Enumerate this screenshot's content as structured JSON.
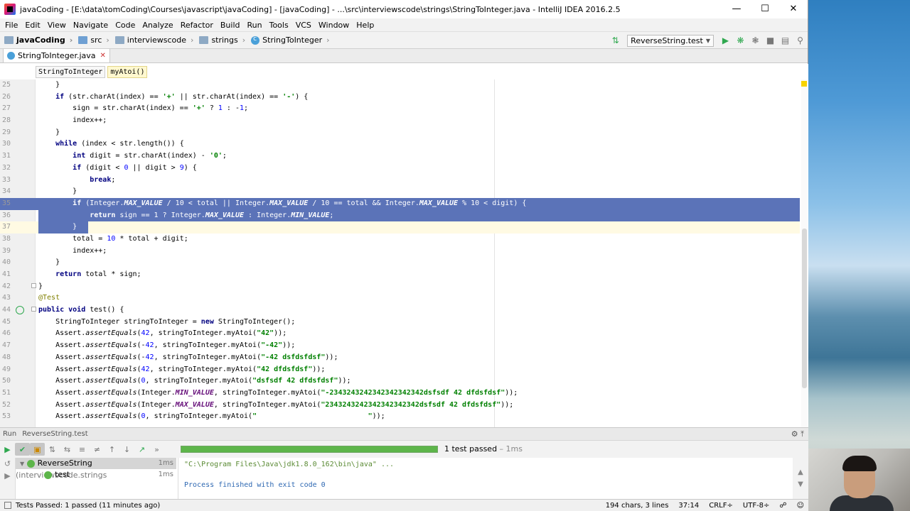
{
  "window": {
    "title": "javaCoding - [E:\\data\\tomCoding\\Courses\\javascript\\javaCoding] - [javaCoding] - ...\\src\\interviewscode\\strings\\StringToInteger.java - IntelliJ IDEA 2016.2.5"
  },
  "menu": [
    "File",
    "Edit",
    "View",
    "Navigate",
    "Code",
    "Analyze",
    "Refactor",
    "Build",
    "Run",
    "Tools",
    "VCS",
    "Window",
    "Help"
  ],
  "breadcrumbs": [
    "javaCoding",
    "src",
    "interviewscode",
    "strings",
    "StringToInteger"
  ],
  "run_config": "ReverseString.test",
  "tabs": {
    "file": "StringToInteger.java"
  },
  "editor_crumbs": [
    "StringToInteger",
    "myAtoi()"
  ],
  "run_panel": {
    "label": "Run",
    "title": "ReverseString.test",
    "status": "1 test passed",
    "status_time": " – 1ms",
    "tree": [
      {
        "name": "ReverseString",
        "pkg": " (interviewscode.strings",
        "time": "1ms"
      },
      {
        "name": "test",
        "pkg": "",
        "time": "1ms"
      }
    ],
    "console": {
      "cmd": "\"C:\\Program Files\\Java\\jdk1.8.0_162\\bin\\java\" ...",
      "finished": "Process finished with exit code 0"
    }
  },
  "statusbar": {
    "left": "Tests Passed: 1 passed (11 minutes ago)",
    "chars": "194 chars, 3 lines",
    "position": "37:14",
    "line_sep": "CRLF÷",
    "encoding": "UTF-8÷"
  }
}
